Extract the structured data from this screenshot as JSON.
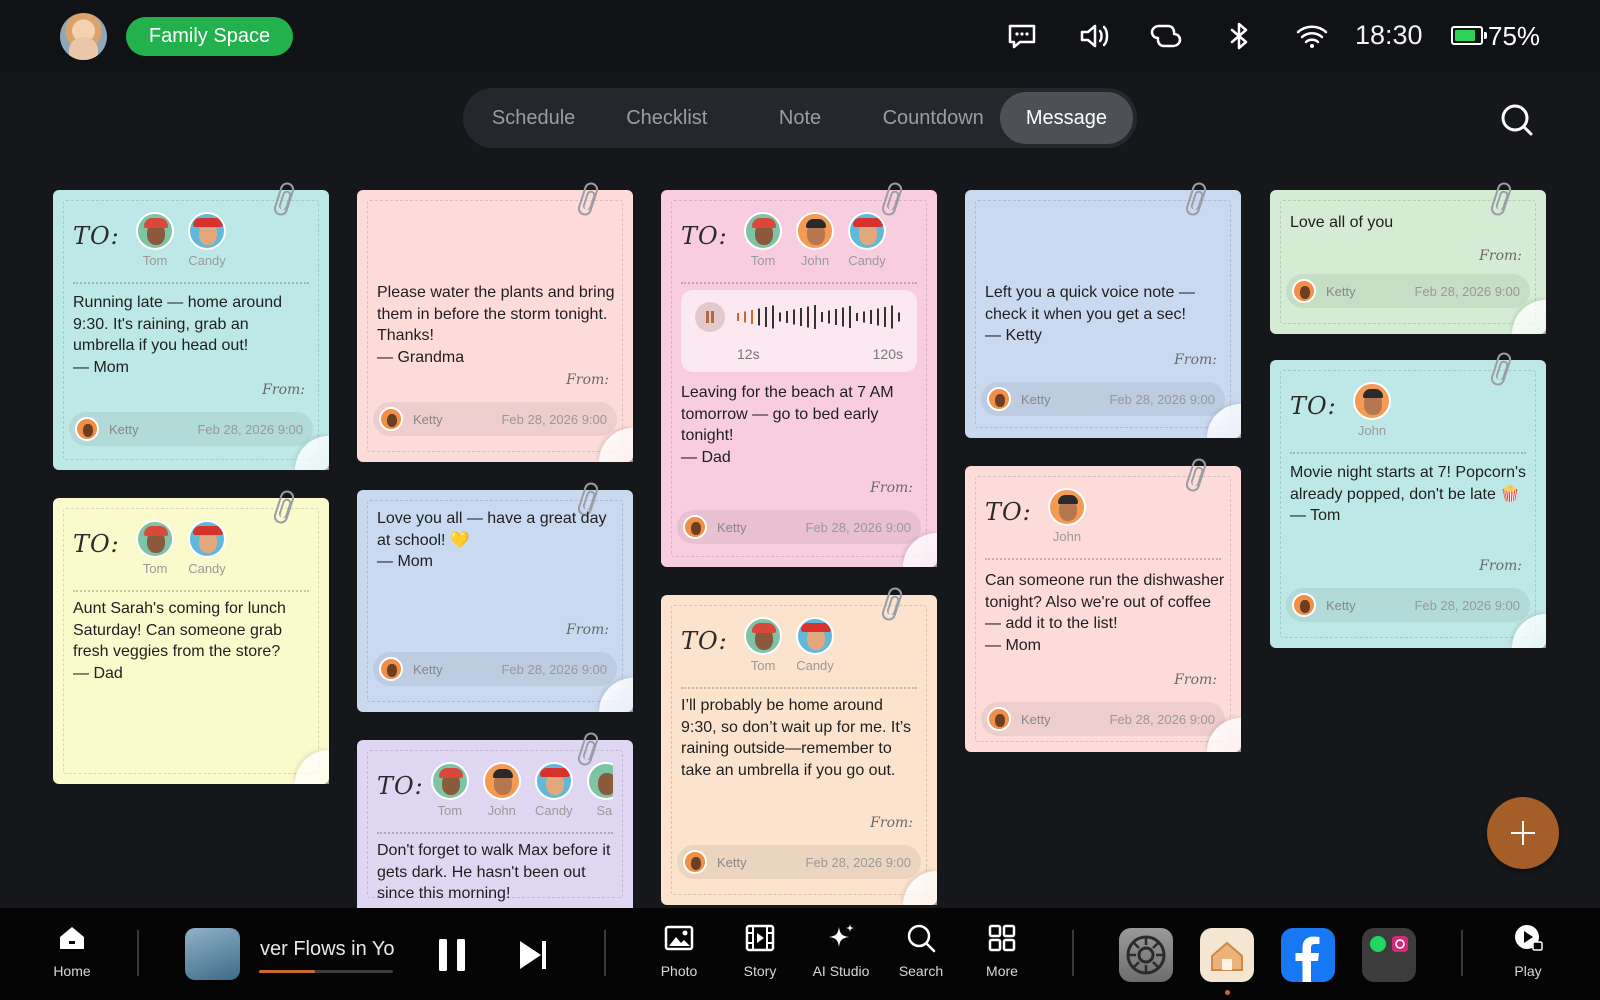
{
  "header": {
    "space_label": "Family Space",
    "time": "18:30",
    "battery_text": "75%",
    "icons": [
      "message-icon",
      "volume-icon",
      "link-icon",
      "bluetooth-icon",
      "wifi-icon",
      "battery-icon"
    ]
  },
  "tabs": [
    {
      "label": "Schedule"
    },
    {
      "label": "Checklist"
    },
    {
      "label": "Note"
    },
    {
      "label": "Countdown"
    },
    {
      "label": "Message",
      "active": true
    }
  ],
  "to_label": "TO:",
  "from_label": "From:",
  "notes": [
    {
      "recipients": [
        "Tom",
        "Candy"
      ],
      "message": "Running late — home around 9:30. It's raining, grab an umbrella if you head out!\n— Mom",
      "sender": "Ketty",
      "date": "Feb 28, 2026 9:00",
      "color": "#bde8e7"
    },
    {
      "recipients": [
        "Tom",
        "Candy"
      ],
      "message": "Aunt Sarah's coming for lunch Saturday! Can someone grab fresh veggies from the store?\n— Dad",
      "sender": "",
      "date": "",
      "color": "#fbfacd"
    },
    {
      "recipients": [],
      "message": "Please water the plants and bring them in before the storm tonight. Thanks!\n— Grandma",
      "sender": "Ketty",
      "date": "Feb 28, 2026 9:00",
      "color": "#fddbd9"
    },
    {
      "recipients": [],
      "message": "Love you all — have a great day at school! 💛\n— Mom",
      "sender": "Ketty",
      "date": "Feb 28, 2026 9:00",
      "color": "#c9d9ef"
    },
    {
      "recipients": [
        "Tom",
        "John",
        "Candy",
        "Sai"
      ],
      "message": "Don't forget to walk Max before it gets dark. He hasn't been out since this morning!",
      "sender": "",
      "date": "",
      "color": "#dfd6f2"
    },
    {
      "recipients": [
        "Tom",
        "John",
        "Candy"
      ],
      "message": "Leaving for the beach at 7 AM tomorrow — go to bed early tonight!\n— Dad",
      "sender": "Ketty",
      "date": "Feb 28, 2026 9:00",
      "color": "#f8cde0",
      "voice": {
        "elapsed": "12s",
        "total": "120s"
      }
    },
    {
      "recipients": [
        "Tom",
        "Candy"
      ],
      "message": "I’ll probably be home around 9:30, so don’t wait up for me. It’s raining outside—remember to take an umbrella if you go out.",
      "sender": "Ketty",
      "date": "Feb 28, 2026 9:00",
      "color": "#fbe3cd"
    },
    {
      "recipients": [],
      "message": "Left you a quick voice note — check it when you get a sec!\n— Ketty",
      "sender": "Ketty",
      "date": "Feb 28, 2026 9:00",
      "color": "#c9d9ef"
    },
    {
      "recipients": [
        "John"
      ],
      "message": "Can someone run the dishwasher tonight? Also we're out of coffee — add it to the list!\n— Mom",
      "sender": "Ketty",
      "date": "Feb 28, 2026 9:00",
      "color": "#fddbd9"
    },
    {
      "recipients": [],
      "message": "Love all of you",
      "sender": "Ketty",
      "date": "Feb 28, 2026 9:00",
      "color": "#d3ecd3"
    },
    {
      "recipients": [
        "John"
      ],
      "message": "Movie night starts at 7! Popcorn's already popped, don't be late 🍿\n— Tom",
      "sender": "Ketty",
      "date": "Feb 28, 2026 9:00",
      "color": "#bde8e7"
    }
  ],
  "dock": {
    "home": "Home",
    "song": "ver Flows in Yo",
    "song_progress": 0.42,
    "photo": "Photo",
    "story": "Story",
    "ai_studio": "AI Studio",
    "search": "Search",
    "more": "More",
    "play": "Play"
  }
}
